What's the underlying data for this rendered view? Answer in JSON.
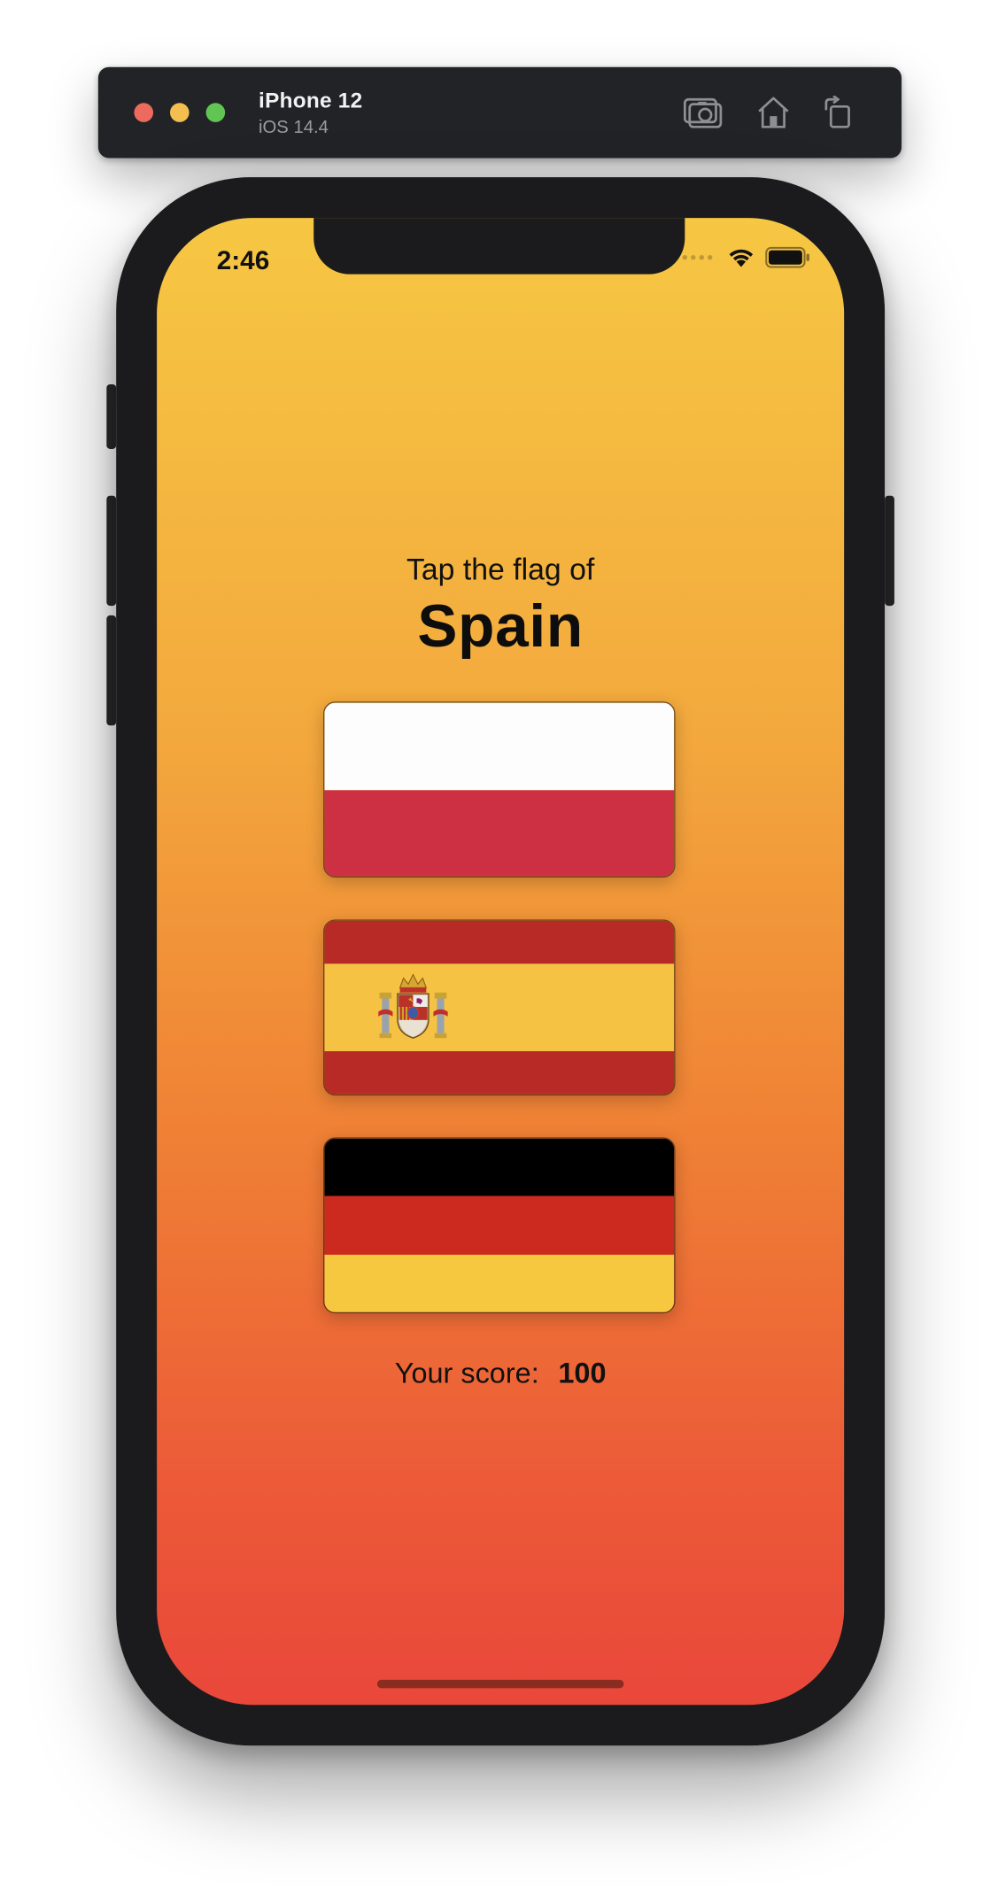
{
  "simulator": {
    "device_name": "iPhone 12",
    "os_version": "iOS 14.4",
    "traffic_lights": {
      "close": "#ed6a5e",
      "minimize": "#f5bf4f",
      "zoom": "#61c554"
    },
    "toolbar": [
      "screenshot-icon",
      "home-icon",
      "rotate-icon"
    ]
  },
  "status_bar": {
    "time": "2:46",
    "icons": [
      "cellular-dots-icon",
      "wifi-icon",
      "battery-icon"
    ]
  },
  "game": {
    "prompt": "Tap the flag of",
    "country": "Spain",
    "flags": [
      {
        "country": "Poland",
        "bands": [
          "#fdfdfd",
          "#cd3043"
        ],
        "weights": [
          1,
          1
        ]
      },
      {
        "country": "Spain",
        "bands": [
          "#b82a26",
          "#f5c243",
          "#b82a26"
        ],
        "weights": [
          1,
          2,
          1
        ],
        "emblem": "coat-of-arms-icon"
      },
      {
        "country": "Germany",
        "bands": [
          "#000000",
          "#cc2a1e",
          "#f5c840"
        ],
        "weights": [
          1,
          1,
          1
        ]
      }
    ],
    "score_label": "Your score:",
    "score_value": "100"
  },
  "colors": {
    "background_top": "#f6c743",
    "background_bottom": "#e9473a"
  }
}
